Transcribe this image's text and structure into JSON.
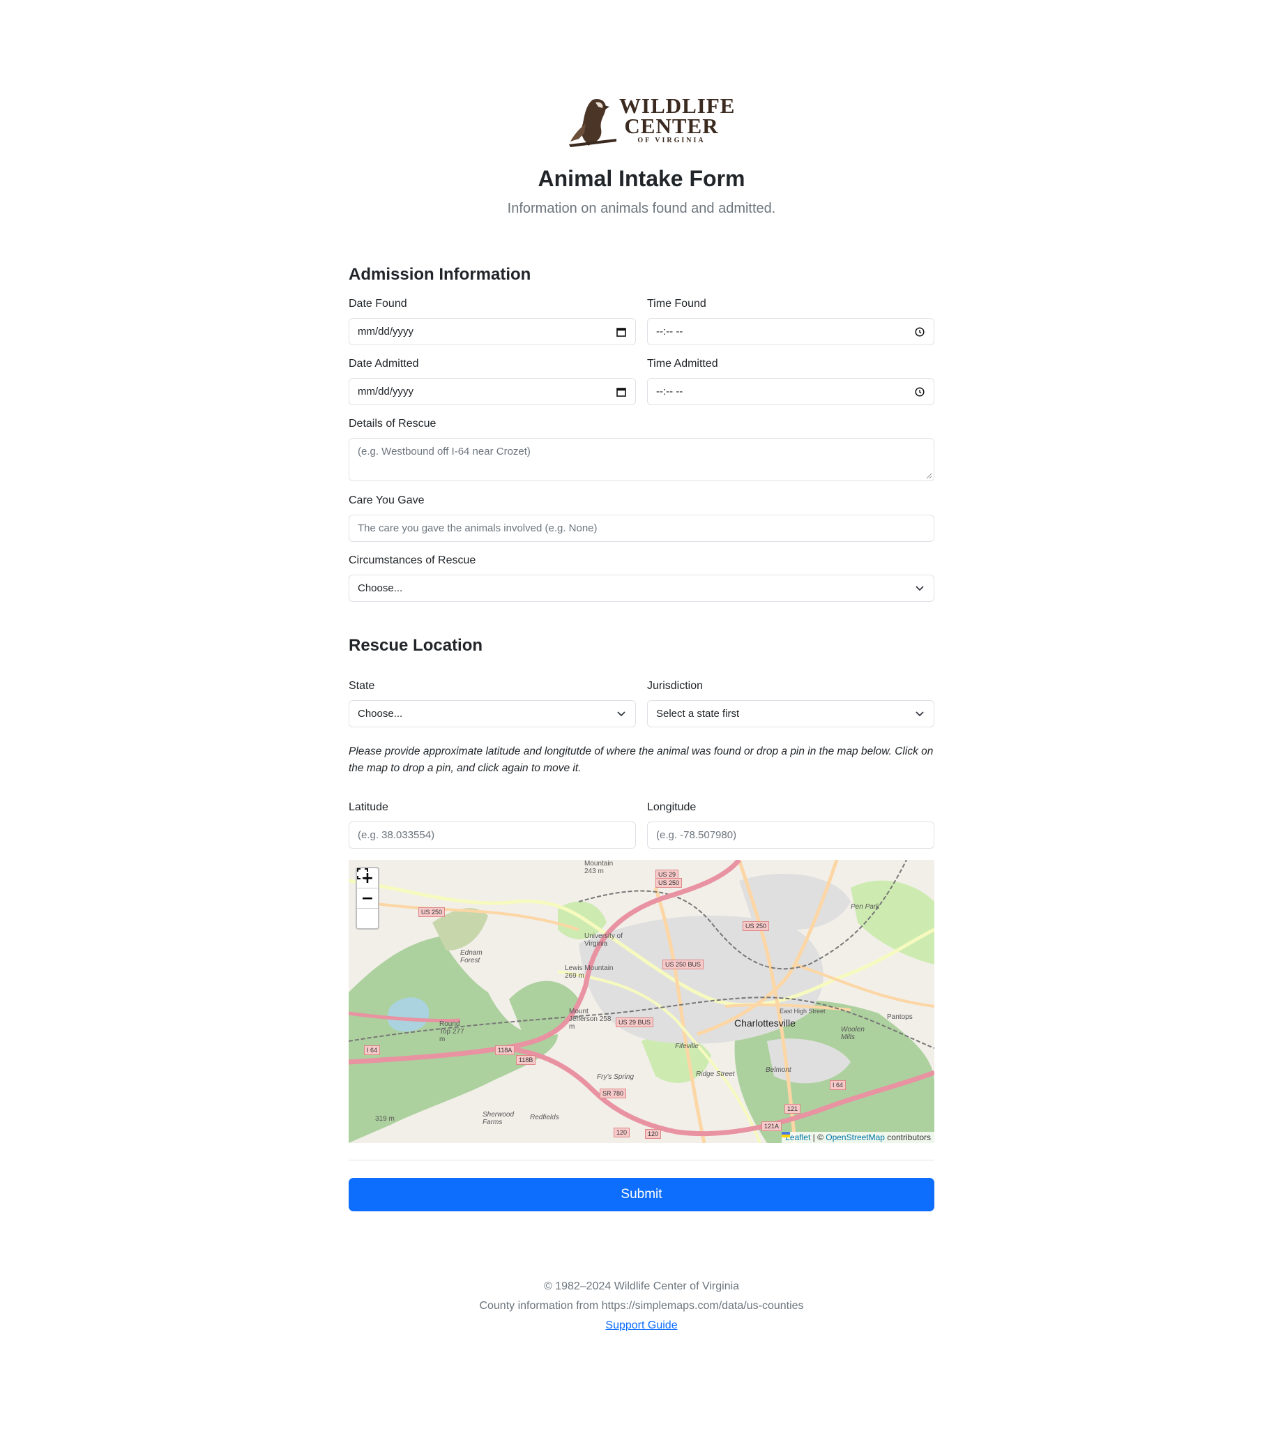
{
  "logo": {
    "line1": "WILDLIFE",
    "line2": "CENTER",
    "line3": "OF VIRGINIA"
  },
  "header": {
    "title": "Animal Intake Form",
    "subtitle": "Information on animals found and admitted."
  },
  "admission": {
    "heading": "Admission Information",
    "date_found_label": "Date Found",
    "date_found_value": "mm/dd/yyyy",
    "time_found_label": "Time Found",
    "time_found_value": "--:-- --",
    "date_admitted_label": "Date Admitted",
    "date_admitted_value": "mm/dd/yyyy",
    "time_admitted_label": "Time Admitted",
    "time_admitted_value": "--:-- --",
    "details_label": "Details of Rescue",
    "details_placeholder": "(e.g. Westbound off I-64 near Crozet)",
    "care_label": "Care You Gave",
    "care_placeholder": "The care you gave the animals involved (e.g. None)",
    "circumstances_label": "Circumstances of Rescue",
    "circumstances_value": "Choose..."
  },
  "location": {
    "heading": "Rescue Location",
    "state_label": "State",
    "state_value": "Choose...",
    "jurisdiction_label": "Jurisdiction",
    "jurisdiction_value": "Select a state first",
    "note": "Please provide approximate latitude and longitutde of where the animal was found or drop a pin in the map below. Click on the map to drop a pin, and click again to move it.",
    "latitude_label": "Latitude",
    "latitude_placeholder": "(e.g. 38.033554)",
    "longitude_label": "Longitude",
    "longitude_placeholder": "(e.g. -78.507980)"
  },
  "map": {
    "zoom_in": "+",
    "zoom_out": "−",
    "fullscreen_icon": "fullscreen-icon",
    "attribution_leaflet": "Leaflet",
    "attribution_sep": " | © ",
    "attribution_osm": "OpenStreetMap",
    "attribution_tail": " contributors",
    "labels": {
      "city": "Charlottesville",
      "uva": "University of Virginia",
      "ednam": "Ednam Forest",
      "penpark": "Pen Park",
      "pantops": "Pantops",
      "belmont": "Belmont",
      "fifeville": "Fifeville",
      "ridge": "Ridge Street",
      "sherwood": "Sherwood Farms",
      "redfields": "Redfields",
      "fryspring": "Fry's Spring",
      "woolen": "Woolen Mills",
      "lewis": "Lewis Mountain 269 m",
      "round": "Round Top 277 m",
      "elev319": "319 m",
      "elev243": "Mountain 243 m",
      "elev258": "Mount Jefferson 258 m",
      "easthigh": "East High Street"
    },
    "shields": {
      "us250w": "US 250",
      "us29": "US 29",
      "us250n": "US 250",
      "us250e": "US 250",
      "us250bus": "US 250 BUS",
      "us29bus": "US 29 BUS",
      "i64w": "I 64",
      "i64e": "I 64",
      "sr780": "SR 780",
      "x118a": "118A",
      "x118b": "118B",
      "x120a": "120",
      "x120b": "120",
      "x121": "121",
      "x121a": "121A"
    }
  },
  "submit_label": "Submit",
  "footer": {
    "copyright": "© 1982–2024 Wildlife Center of Virginia",
    "county_info": "County information from https://simplemaps.com/data/us-counties",
    "support_link": "Support Guide"
  }
}
